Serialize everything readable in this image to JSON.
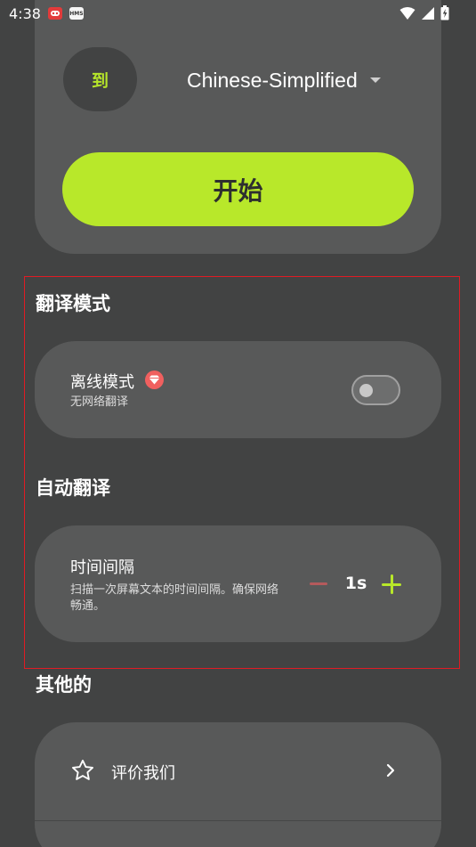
{
  "status_bar": {
    "time": "4:38",
    "icons": [
      "game-notification-icon",
      "hms-icon",
      "wifi-icon",
      "signal-icon",
      "battery-charging-icon"
    ],
    "hms_label": "HMS"
  },
  "translate": {
    "to_label": "到",
    "target_language": "Chinese-Simplified",
    "start_label": "开始"
  },
  "translation_mode": {
    "section_title": "翻译模式",
    "offline_title": "离线模式",
    "offline_desc": "无网络翻译",
    "offline_enabled": false,
    "premium_icon": "diamond-icon"
  },
  "auto_translate": {
    "section_title": "自动翻译",
    "interval_title": "时间间隔",
    "interval_desc": "扫描一次屏幕文本的时间间隔。确保网络畅通。",
    "interval_value": "1s"
  },
  "other": {
    "section_title": "其他的",
    "rate_label": "评价我们"
  },
  "colors": {
    "background": "#424343",
    "card": "#585959",
    "accent": "#b8e82a",
    "highlight": "#e01b24"
  }
}
